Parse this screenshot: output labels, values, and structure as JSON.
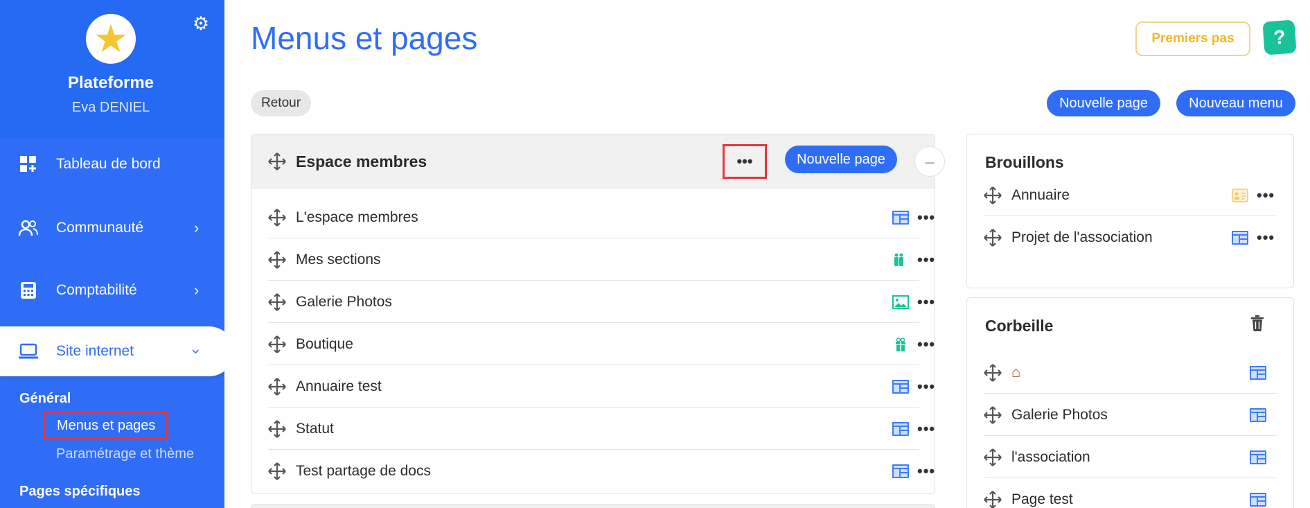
{
  "sidebar": {
    "brand": "Plateforme",
    "user": "Eva DENIEL",
    "nav": [
      {
        "label": "Tableau de bord"
      },
      {
        "label": "Communauté"
      },
      {
        "label": "Comptabilité"
      },
      {
        "label": "Site internet"
      }
    ],
    "section_general": "Général",
    "link_menus": "Menus et pages",
    "link_settings": "Paramétrage et thème",
    "section_specific": "Pages spécifiques"
  },
  "header": {
    "title": "Menus et pages",
    "back": "Retour",
    "first_steps": "Premiers pas",
    "help": "?",
    "new_page": "Nouvelle page",
    "new_menu": "Nouveau menu"
  },
  "menu_panel": {
    "title": "Espace membres",
    "more": "•••",
    "new_page": "Nouvelle page",
    "collapse": "–",
    "rows": [
      {
        "label": "L'espace membres",
        "icon": "page-layout-icon"
      },
      {
        "label": "Mes sections",
        "icon": "people-icon"
      },
      {
        "label": "Galerie Photos",
        "icon": "image-icon"
      },
      {
        "label": "Boutique",
        "icon": "gift-icon"
      },
      {
        "label": "Annuaire test",
        "icon": "page-layout-icon"
      },
      {
        "label": "Statut",
        "icon": "page-layout-icon"
      },
      {
        "label": "Test partage de docs",
        "icon": "page-layout-icon"
      }
    ]
  },
  "drafts": {
    "title": "Brouillons",
    "rows": [
      {
        "label": "Annuaire",
        "icon": "contact-card-icon"
      },
      {
        "label": "Projet de l'association",
        "icon": "page-layout-icon"
      }
    ]
  },
  "trash": {
    "title": "Corbeille",
    "rows": [
      {
        "label": "",
        "icon": "page-layout-icon"
      },
      {
        "label": "Galerie Photos",
        "icon": "page-layout-icon"
      },
      {
        "label": "l'association",
        "icon": "page-layout-icon"
      },
      {
        "label": "Page test",
        "icon": "page-layout-icon"
      }
    ]
  },
  "colors": {
    "primary": "#2f6df6",
    "accent_yellow": "#f0b731",
    "help_green": "#18c39a",
    "highlight_red": "#e8343b"
  },
  "dots": "•••"
}
